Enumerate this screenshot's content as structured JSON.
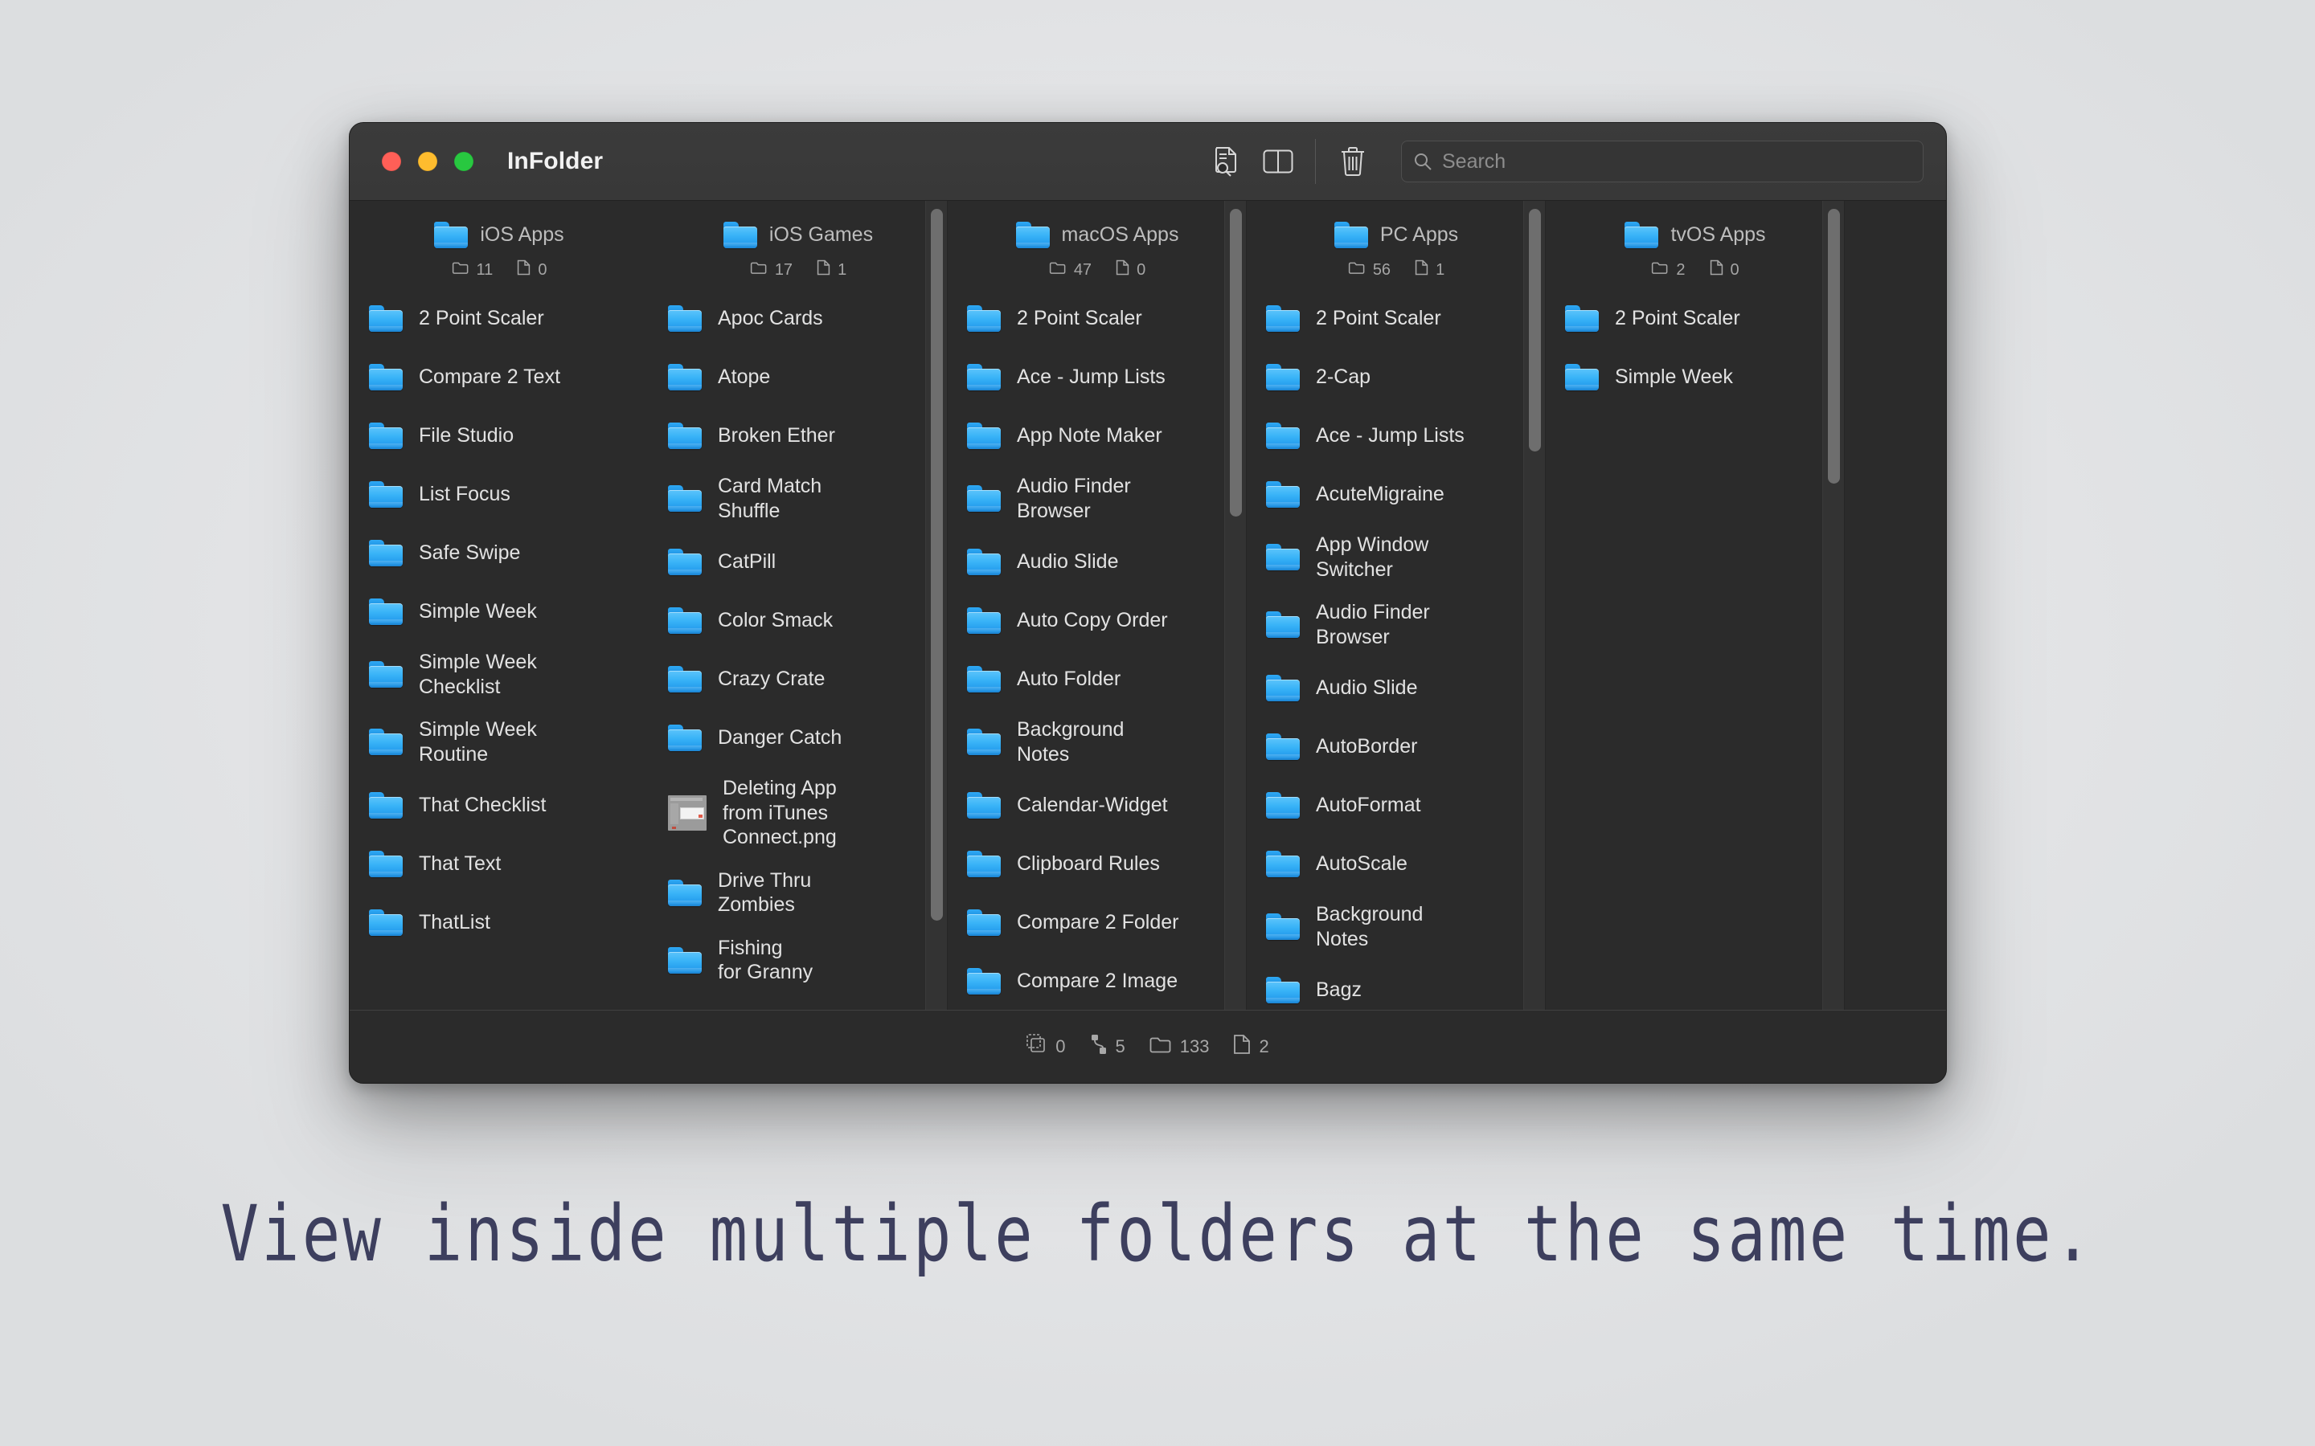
{
  "caption": "View inside multiple folders at the same time.",
  "window": {
    "title": "InFolder",
    "traffic_lights": {
      "close": "close",
      "minimize": "minimize",
      "zoom": "zoom"
    },
    "toolbar": {
      "inspect_label": "file-inspector",
      "split_label": "split-view",
      "trash_label": "delete",
      "search_placeholder": "Search",
      "search_value": ""
    },
    "statusbar": {
      "selected_count": "0",
      "alias_count": "5",
      "folder_count": "133",
      "file_count": "2"
    }
  },
  "colors": {
    "window_bg": "#2b2b2b",
    "titlebar_bg": "#3a3a3a",
    "folder_blue": "#38b3f7",
    "text_primary": "#e2e2e2",
    "text_secondary": "#a5a5a5",
    "caption": "#3d3f5e",
    "backdrop": "#e7e8ea"
  },
  "columns": [
    {
      "name": "iOS Apps",
      "folder_count": "11",
      "file_count": "0",
      "scrollbar": null,
      "items": [
        {
          "label": "2 Point Scaler",
          "type": "folder"
        },
        {
          "label": "Compare 2 Text",
          "type": "folder"
        },
        {
          "label": "File Studio",
          "type": "folder"
        },
        {
          "label": "List Focus",
          "type": "folder"
        },
        {
          "label": "Safe Swipe",
          "type": "folder"
        },
        {
          "label": "Simple Week",
          "type": "folder"
        },
        {
          "label": "Simple Week\nChecklist",
          "type": "folder"
        },
        {
          "label": "Simple Week\nRoutine",
          "type": "folder"
        },
        {
          "label": "That Checklist",
          "type": "folder"
        },
        {
          "label": "That Text",
          "type": "folder"
        },
        {
          "label": "ThatList",
          "type": "folder"
        }
      ]
    },
    {
      "name": "iOS Games",
      "folder_count": "17",
      "file_count": "1",
      "scrollbar": {
        "top_pct": 1,
        "height_pct": 88
      },
      "items": [
        {
          "label": "Apoc Cards",
          "type": "folder"
        },
        {
          "label": "Atope",
          "type": "folder"
        },
        {
          "label": "Broken Ether",
          "type": "folder"
        },
        {
          "label": "Card Match\nShuffle",
          "type": "folder"
        },
        {
          "label": "CatPill",
          "type": "folder"
        },
        {
          "label": "Color Smack",
          "type": "folder"
        },
        {
          "label": "Crazy Crate",
          "type": "folder"
        },
        {
          "label": "Danger Catch",
          "type": "folder"
        },
        {
          "label": "Deleting App\nfrom iTunes\nConnect.png",
          "type": "image"
        },
        {
          "label": "Drive Thru\nZombies",
          "type": "folder"
        },
        {
          "label": "Fishing\nfor Granny",
          "type": "folder"
        }
      ]
    },
    {
      "name": "macOS Apps",
      "folder_count": "47",
      "file_count": "0",
      "scrollbar": {
        "top_pct": 1,
        "height_pct": 38
      },
      "items": [
        {
          "label": "2 Point Scaler",
          "type": "folder"
        },
        {
          "label": "Ace - Jump Lists",
          "type": "folder"
        },
        {
          "label": "App Note Maker",
          "type": "folder"
        },
        {
          "label": "Audio Finder\nBrowser",
          "type": "folder"
        },
        {
          "label": "Audio Slide",
          "type": "folder"
        },
        {
          "label": "Auto Copy Order",
          "type": "folder"
        },
        {
          "label": "Auto Folder",
          "type": "folder"
        },
        {
          "label": "Background\nNotes",
          "type": "folder"
        },
        {
          "label": "Calendar-Widget",
          "type": "folder"
        },
        {
          "label": "Clipboard Rules",
          "type": "folder"
        },
        {
          "label": "Compare 2 Folder",
          "type": "folder"
        },
        {
          "label": "Compare 2 Image",
          "type": "folder"
        }
      ]
    },
    {
      "name": "PC Apps",
      "folder_count": "56",
      "file_count": "1",
      "scrollbar": {
        "top_pct": 1,
        "height_pct": 30
      },
      "items": [
        {
          "label": "2 Point Scaler",
          "type": "folder"
        },
        {
          "label": "2-Cap",
          "type": "folder"
        },
        {
          "label": "Ace - Jump Lists",
          "type": "folder"
        },
        {
          "label": "AcuteMigraine",
          "type": "folder"
        },
        {
          "label": "App Window\nSwitcher",
          "type": "folder"
        },
        {
          "label": "Audio Finder\nBrowser",
          "type": "folder"
        },
        {
          "label": "Audio Slide",
          "type": "folder"
        },
        {
          "label": "AutoBorder",
          "type": "folder"
        },
        {
          "label": "AutoFormat",
          "type": "folder"
        },
        {
          "label": "AutoScale",
          "type": "folder"
        },
        {
          "label": "Background\nNotes",
          "type": "folder"
        },
        {
          "label": "Bagz",
          "type": "folder"
        }
      ]
    },
    {
      "name": "tvOS Apps",
      "folder_count": "2",
      "file_count": "0",
      "scrollbar": {
        "top_pct": 1,
        "height_pct": 34
      },
      "items": [
        {
          "label": "2 Point Scaler",
          "type": "folder"
        },
        {
          "label": "Simple Week",
          "type": "folder"
        }
      ]
    }
  ]
}
